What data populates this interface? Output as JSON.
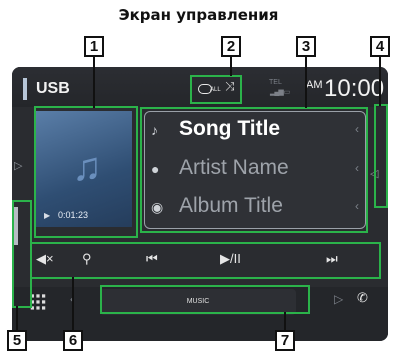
{
  "heading": "Экран управления",
  "status": {
    "source_label": "USB",
    "repeat_sub": "ALL",
    "tel_label": "TEL",
    "ampm": "AM",
    "clock": "10:00"
  },
  "playback": {
    "elapsed_time": "0:01:23"
  },
  "track_info": {
    "song_title": "Song Title",
    "artist_name": "Artist Name",
    "album_title": "Album Title"
  },
  "bottom_bar": {
    "tab_label": "MUSIC"
  },
  "callouts": [
    "1",
    "2",
    "3",
    "4",
    "5",
    "6",
    "7"
  ],
  "colors": {
    "highlight": "#2bb34a",
    "screen_bg": "#2a2c30",
    "album_art": "#3f638e",
    "text_primary": "#ffffff",
    "text_secondary": "#9ea3aa"
  },
  "icons": [
    "repeat-icon",
    "shuffle-icon",
    "signal-icon",
    "music-note-icon",
    "person-icon",
    "disc-icon",
    "mute-icon",
    "search-icon",
    "previous-icon",
    "play-pause-icon",
    "next-icon",
    "grid-icon",
    "phone-icon"
  ]
}
